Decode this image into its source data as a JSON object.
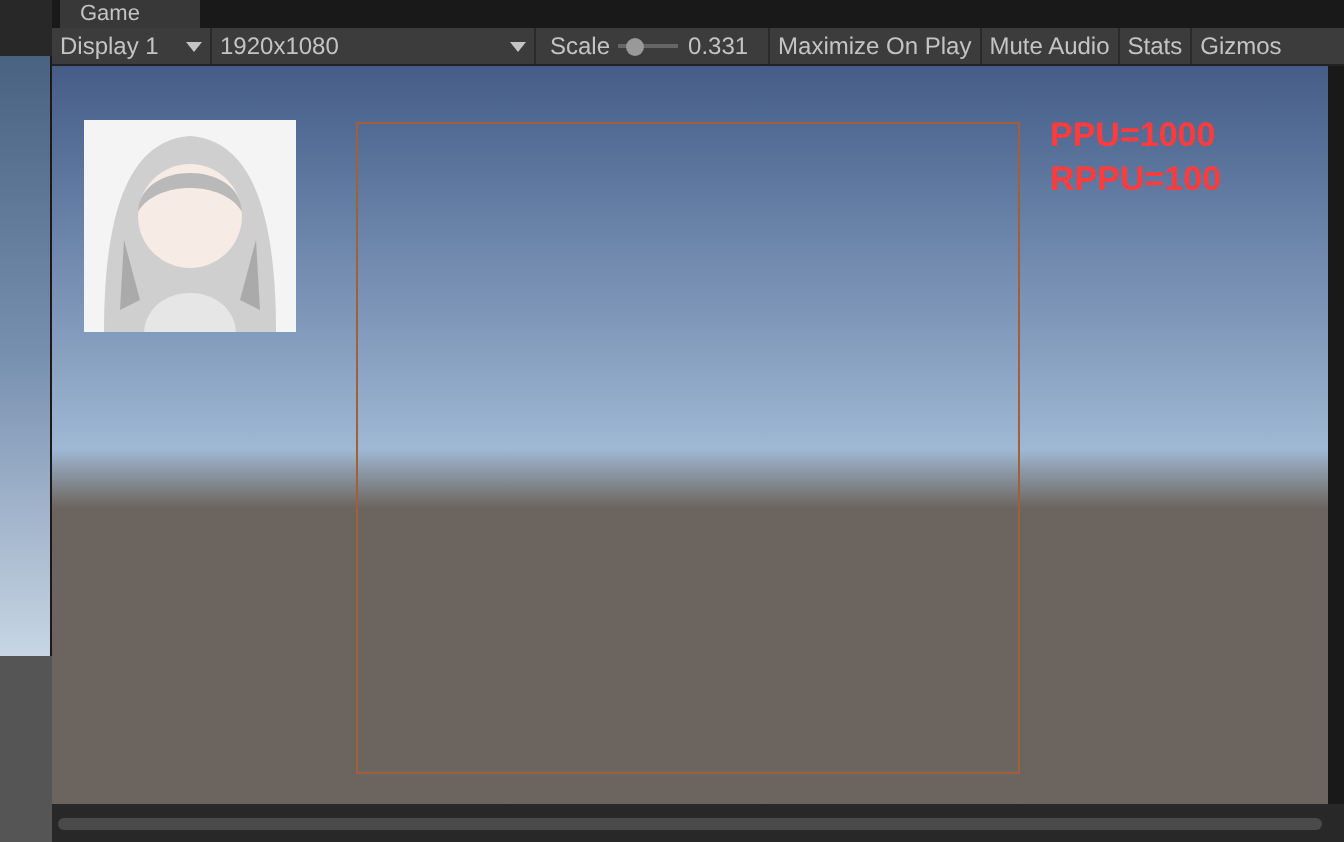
{
  "tab": {
    "label": "Game"
  },
  "toolbar": {
    "display": "Display 1",
    "resolution": "1920x1080",
    "scale_label": "Scale",
    "scale": {
      "level": 0.25,
      "reading": "0.331"
    },
    "buttons": [
      {
        "label": "Maximize On Play",
        "selected": false
      },
      {
        "label": "Mute Audio",
        "selected": false
      },
      {
        "label": "Stats",
        "selected": false
      },
      {
        "label": "Gizmos",
        "selected": false
      }
    ]
  },
  "overlay": [
    {
      "text": "PPU=1000",
      "color": "#ff3b3b"
    },
    {
      "text": "RPPU=100",
      "color": "#ff3b3b"
    }
  ]
}
